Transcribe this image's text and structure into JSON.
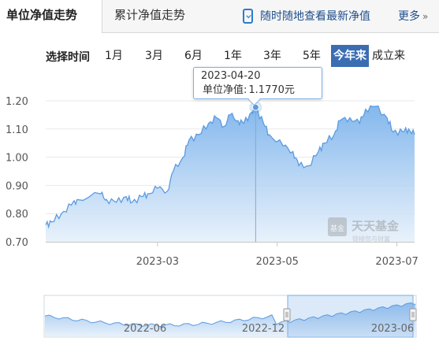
{
  "tabs": {
    "unit_nav": "单位净值走势",
    "cumulative_nav": "累计净值走势",
    "mobile": "随时随地查看最新净值",
    "more": "更多",
    "more_chevron": "»"
  },
  "periods": {
    "label": "选择时间",
    "items": [
      "1月",
      "3月",
      "6月",
      "1年",
      "3年",
      "5年",
      "今年来",
      "成立来"
    ],
    "active": "今年来"
  },
  "tooltip": {
    "date": "2023-04-20",
    "label": "单位净值:",
    "value": "1.1770元"
  },
  "watermark": {
    "name": "天天基金",
    "badge": "基金",
    "slogan": "链接您与财富"
  },
  "colors": {
    "accent": "#3b6db3",
    "line": "#5b9be0",
    "area_top": "#7cb3ec",
    "area_bottom": "#e6f0fb"
  },
  "chart_data": {
    "type": "area",
    "title": "",
    "xlabel": "",
    "ylabel": "",
    "ylim": [
      0.7,
      1.2
    ],
    "yticks": [
      "0.70",
      "0.80",
      "0.90",
      "1.00",
      "1.10",
      "1.20"
    ],
    "xticks": [
      "2023-03",
      "2023-05",
      "2023-07"
    ],
    "grid": true,
    "series": [
      {
        "x": [
          "2023-01-03",
          "2023-01-06",
          "2023-01-11",
          "2023-01-16",
          "2023-01-19",
          "2023-01-31",
          "2023-02-03",
          "2023-02-08",
          "2023-02-13",
          "2023-02-16",
          "2023-02-21",
          "2023-02-24",
          "2023-03-01",
          "2023-03-06",
          "2023-03-09",
          "2023-03-14",
          "2023-03-17",
          "2023-03-22",
          "2023-03-27",
          "2023-03-31",
          "2023-04-04",
          "2023-04-07",
          "2023-04-11",
          "2023-04-14",
          "2023-04-18",
          "2023-04-20",
          "2023-04-24",
          "2023-04-27",
          "2023-05-04",
          "2023-05-09",
          "2023-05-12",
          "2023-05-17",
          "2023-05-22",
          "2023-05-25",
          "2023-05-30",
          "2023-06-02",
          "2023-06-07",
          "2023-06-12",
          "2023-06-15",
          "2023-06-20",
          "2023-06-26",
          "2023-06-29",
          "2023-07-04",
          "2023-07-07",
          "2023-07-10"
        ],
        "values": [
          0.76,
          0.77,
          0.8,
          0.83,
          0.85,
          0.87,
          0.85,
          0.84,
          0.86,
          0.84,
          0.86,
          0.87,
          0.89,
          0.88,
          0.95,
          1.0,
          1.06,
          1.08,
          1.12,
          1.14,
          1.11,
          1.15,
          1.13,
          1.12,
          1.16,
          1.177,
          1.12,
          1.08,
          1.04,
          1.02,
          0.97,
          0.97,
          1.02,
          1.05,
          1.08,
          1.13,
          1.14,
          1.12,
          1.17,
          1.18,
          1.14,
          1.09,
          1.09,
          1.1,
          1.08
        ]
      }
    ]
  },
  "navigator": {
    "xticks": [
      "2022-06",
      "2022-12",
      "2023-06"
    ]
  }
}
